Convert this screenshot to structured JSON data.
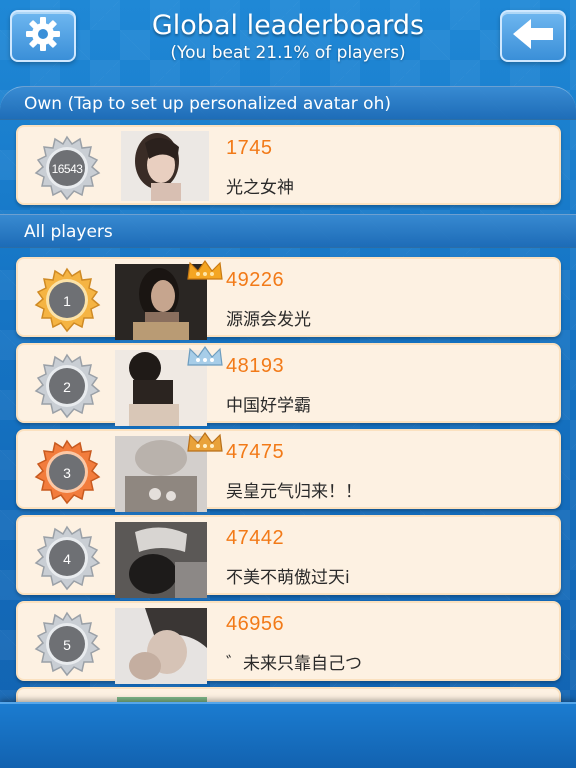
{
  "header": {
    "title": "Global leaderboards",
    "subtitle": "(You beat 21.1% of players)",
    "settings_icon": "gear-icon",
    "back_icon": "arrow-left-icon"
  },
  "own_section": {
    "label": "Own (Tap to set up personalized avatar oh)",
    "entry": {
      "rank": "16543",
      "score": "1745",
      "name": "光之女神"
    }
  },
  "all_section": {
    "label": "All players",
    "entries": [
      {
        "rank": "1",
        "score": "49226",
        "name": "源源会发光",
        "medal": "gold",
        "crown": "gold"
      },
      {
        "rank": "2",
        "score": "48193",
        "name": "中国好学霸",
        "medal": "silver",
        "crown": "silver"
      },
      {
        "rank": "3",
        "score": "47475",
        "name": "吴皇元气归来！！",
        "medal": "bronze",
        "crown": "bronze"
      },
      {
        "rank": "4",
        "score": "47442",
        "name": "不美不萌傲过天i",
        "medal": "silver"
      },
      {
        "rank": "5",
        "score": "46956",
        "name": "゛未来只靠自己つ",
        "medal": "silver"
      }
    ]
  },
  "colors": {
    "score": "#f27a18",
    "card_bg": "#fdf1e2",
    "gold": "#f0a93a",
    "silver": "#b9bfc6",
    "bronze": "#f07a3a"
  }
}
